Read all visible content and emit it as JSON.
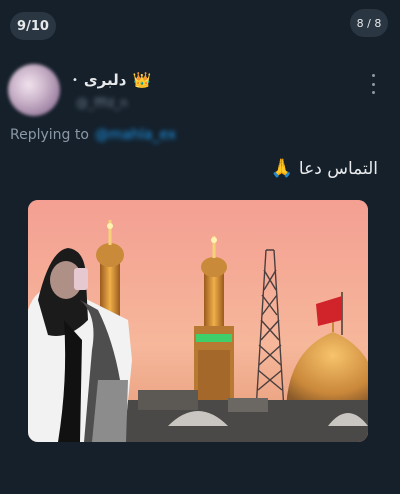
{
  "gallery": {
    "counter_left": "9/10",
    "counter_right": "8 / 8"
  },
  "tweet": {
    "display_name": "دلبری",
    "crown_icon": "crown-emoji",
    "dot": "•",
    "handle": "@_fffd_n",
    "reply_prefix": "Replying to",
    "reply_handle": "@mahla_ex",
    "text": "التماس دعا",
    "text_icon": "praying-hands-emoji",
    "more_icon": "vertical-ellipsis-icon"
  },
  "colors": {
    "background": "#15202b",
    "link": "#1d9bf0",
    "muted": "#8b98a5"
  }
}
